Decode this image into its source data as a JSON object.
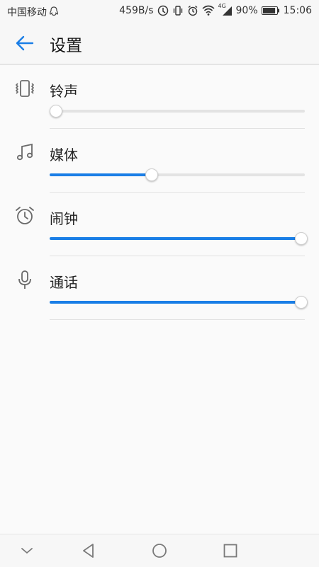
{
  "status_bar": {
    "carrier": "中国移动",
    "net_speed": "459B/s",
    "network": "4G",
    "battery_percent": "90%",
    "battery_level": 0.9,
    "time": "15:06"
  },
  "header": {
    "title": "设置"
  },
  "volume_rows": [
    {
      "label": "铃声",
      "icon": "vibrate-icon",
      "level": 0.0
    },
    {
      "label": "媒体",
      "icon": "music-note-icon",
      "level": 0.4
    },
    {
      "label": "闹钟",
      "icon": "alarm-clock-icon",
      "level": 1.0
    },
    {
      "label": "通话",
      "icon": "microphone-icon",
      "level": 1.0
    }
  ],
  "nav": [
    "collapse-icon",
    "back-triangle-icon",
    "home-circle-icon",
    "recents-square-icon"
  ],
  "colors": {
    "accent": "#1a7ee6",
    "track": "#e3e3e3",
    "icon": "#6a6a6a"
  }
}
